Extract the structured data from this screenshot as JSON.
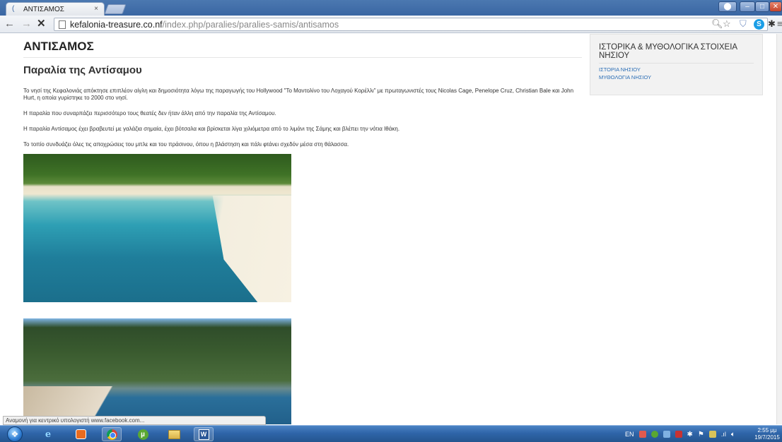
{
  "browser": {
    "tab_title": "ΑΝΤΙΣΑΜΟΣ",
    "tab_close": "×",
    "url_host": "kefalonia-treasure.co.nf",
    "url_path": "/index.php/paralies/paralies-samis/antisamos",
    "status_text": "Αναμονή για κεντρικό υπολογιστή www.facebook.com..."
  },
  "article": {
    "title": "ΑΝΤΙΣΑΜΟΣ",
    "subtitle": "Παραλία της Αντίσαμου",
    "paragraphs": [
      "Το νησί της Κεφαλονιάς απόκτησε επιπλέον αίγλη και δημοσιότητα λόγω της παραγωγής του Hollywood \"Το Μαντολίνο του Λοχαγού Κορέλλι\" με πρωταγωνιστές τους Nicolas Cage, Penelope Cruz, Christian Bale και John Hurt, η οποία γυρίστηκε το 2000 στο νησί.",
      "Η παραλία που συναρπάζει περισσότερο τους θεατές δεν ήταν άλλη από την παραλία της Αντίσαμου.",
      "Η παραλία Αντίσαμος έχει βραβευτεί με γαλάζια σημαία, έχει βότσαλα και βρίσκεται λίγα χιλιόμετρα από το λιμάνι της Σάμης και βλέπει την νότια Ιθάκη.",
      "Το τοπίο συνδυάζει όλες τις αποχρώσεις του μπλε και του πράσινου, όπου η βλάστηση και πάλι φτάνει σχεδόν μέσα στη θάλασσα."
    ]
  },
  "sidebar": {
    "heading": "ΙΣΤΟΡΙΚΑ & ΜΥΘΟΛΟΓΙΚΑ ΣΤΟΙΧΕΙΑ ΝΗΣΙΟΥ",
    "links": [
      "ΙΣΤΟΡΙΑ ΝΗΣΙΟΥ",
      "ΜΥΘΟΛΟΓΙΑ ΝΗΣΙΟΥ"
    ]
  },
  "taskbar": {
    "language": "EN",
    "time": "2:55 μμ",
    "date": "19/7/2015"
  },
  "colors": {
    "link": "#2a6db5",
    "taskbar": "#2f65a9"
  }
}
